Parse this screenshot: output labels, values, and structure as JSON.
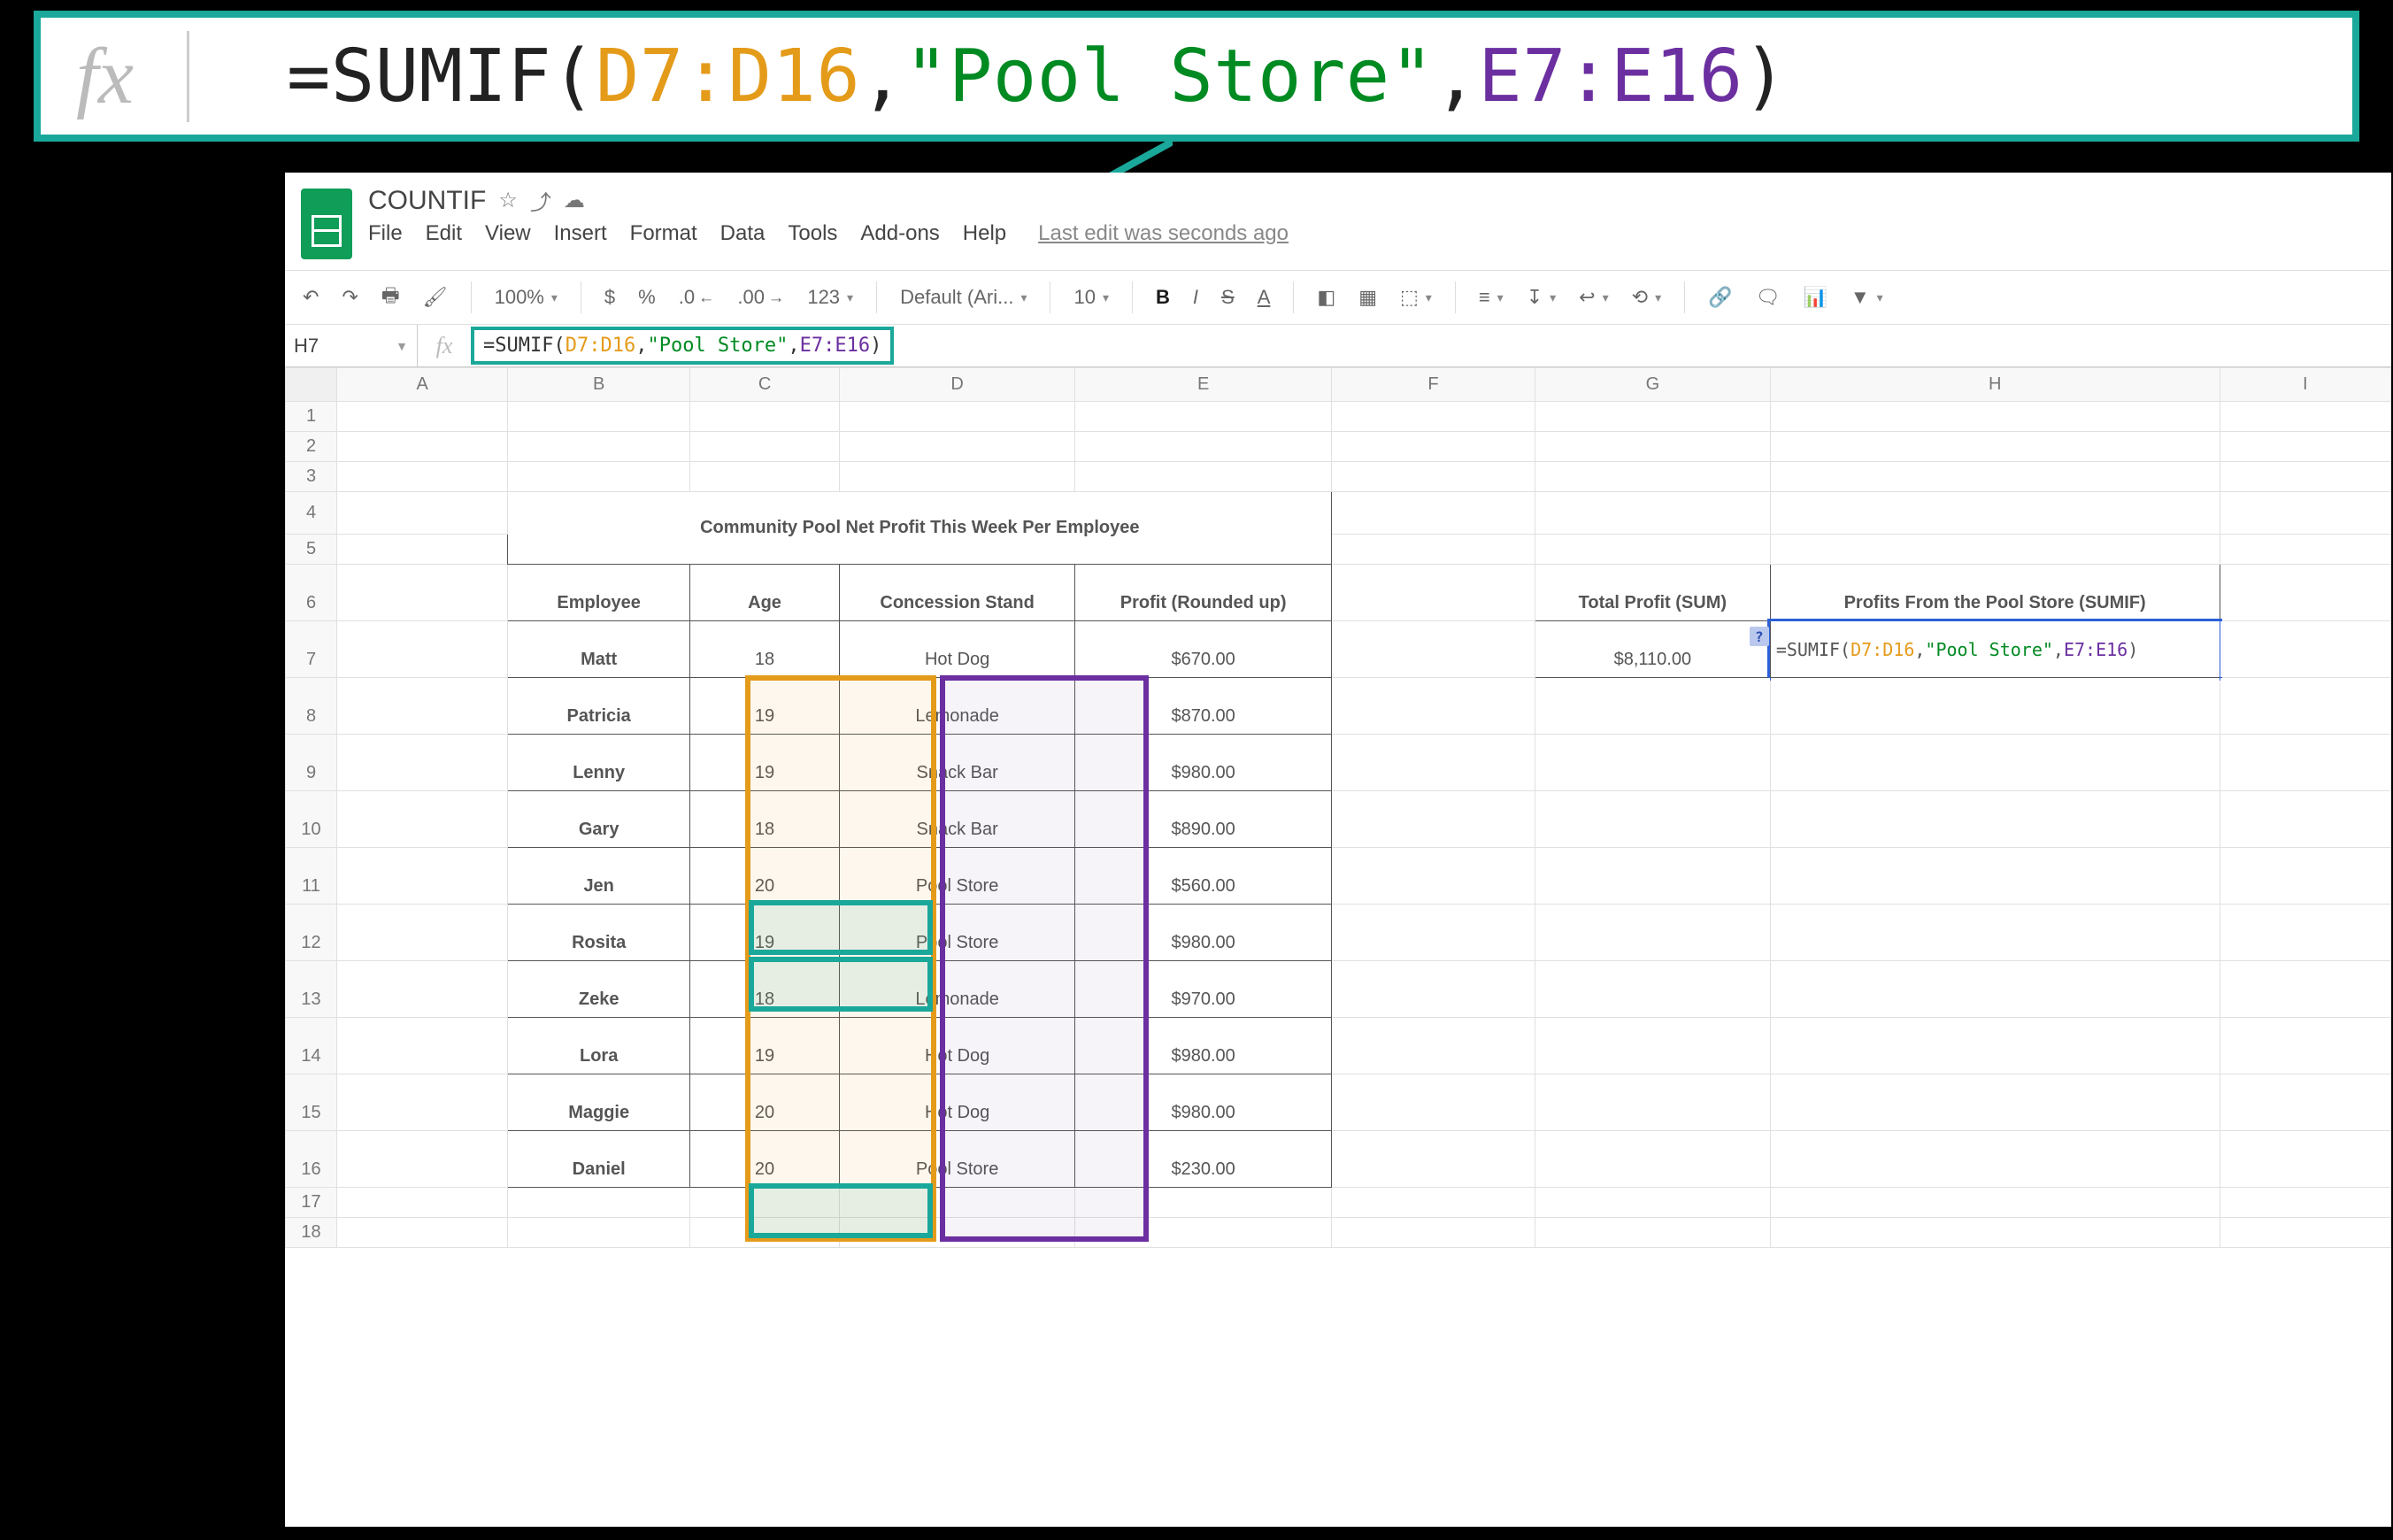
{
  "callout": {
    "eq": "=SUMIF(",
    "r1": "D7:D16",
    "c1": ",",
    "crit": "\"Pool Store\"",
    "c2": ",",
    "r2": "E7:E16",
    "close": ")"
  },
  "doc": {
    "title": "COUNTIF",
    "last_edit": "Last edit was seconds ago"
  },
  "menu": {
    "file": "File",
    "edit": "Edit",
    "view": "View",
    "insert": "Insert",
    "format": "Format",
    "data": "Data",
    "tools": "Tools",
    "addons": "Add-ons",
    "help": "Help"
  },
  "toolbar": {
    "zoom": "100%",
    "dollar": "$",
    "percent": "%",
    "dec_less": ".0",
    "dec_more": ".00",
    "num": "123",
    "font": "Default (Ari...",
    "size": "10",
    "bold": "B",
    "italic": "I",
    "strike": "S",
    "color": "A"
  },
  "namebox": "H7",
  "fbar": {
    "eq": "=SUMIF(",
    "r1": "D7:D16",
    "c1": ",",
    "crit": "\"Pool Store\"",
    "c2": ",",
    "r2": "E7:E16",
    "close": ")"
  },
  "cols": [
    "A",
    "B",
    "C",
    "D",
    "E",
    "F",
    "G",
    "H",
    "I"
  ],
  "rows": [
    "1",
    "2",
    "3",
    "4",
    "5",
    "6",
    "7",
    "8",
    "9",
    "10",
    "11",
    "12",
    "13",
    "14",
    "15",
    "16",
    "17",
    "18"
  ],
  "table": {
    "title": "Community Pool Net Profit This Week Per Employee",
    "headers": {
      "emp": "Employee",
      "age": "Age",
      "stand": "Concession Stand",
      "profit": "Profit (Rounded up)"
    },
    "rows": [
      {
        "emp": "Matt",
        "age": "18",
        "stand": "Hot Dog",
        "profit": "$670.00"
      },
      {
        "emp": "Patricia",
        "age": "19",
        "stand": "Lemonade",
        "profit": "$870.00"
      },
      {
        "emp": "Lenny",
        "age": "19",
        "stand": "Snack Bar",
        "profit": "$980.00"
      },
      {
        "emp": "Gary",
        "age": "18",
        "stand": "Snack Bar",
        "profit": "$890.00"
      },
      {
        "emp": "Jen",
        "age": "20",
        "stand": "Pool Store",
        "profit": "$560.00"
      },
      {
        "emp": "Rosita",
        "age": "19",
        "stand": "Pool Store",
        "profit": "$980.00"
      },
      {
        "emp": "Zeke",
        "age": "18",
        "stand": "Lemonade",
        "profit": "$970.00"
      },
      {
        "emp": "Lora",
        "age": "19",
        "stand": "Hot Dog",
        "profit": "$980.00"
      },
      {
        "emp": "Maggie",
        "age": "20",
        "stand": "Hot Dog",
        "profit": "$980.00"
      },
      {
        "emp": "Daniel",
        "age": "20",
        "stand": "Pool Store",
        "profit": "$230.00"
      }
    ]
  },
  "summary": {
    "sum_head": "Total Profit (SUM)",
    "sumif_head": "Profits From the Pool Store (SUMIF)",
    "sum_val": "$8,110.00"
  },
  "editing": {
    "eq": "=SUMIF(",
    "r1": "D7:D16",
    "c1": ",",
    "crit": "\"Pool Store\"",
    "c2": ",",
    "r2": "E7:E16",
    "close": ")",
    "q": "?"
  },
  "chart_data": {
    "type": "table",
    "title": "Community Pool Net Profit This Week Per Employee",
    "columns": [
      "Employee",
      "Age",
      "Concession Stand",
      "Profit (Rounded up)"
    ],
    "rows": [
      [
        "Matt",
        18,
        "Hot Dog",
        670.0
      ],
      [
        "Patricia",
        19,
        "Lemonade",
        870.0
      ],
      [
        "Lenny",
        19,
        "Snack Bar",
        980.0
      ],
      [
        "Gary",
        18,
        "Snack Bar",
        890.0
      ],
      [
        "Jen",
        20,
        "Pool Store",
        560.0
      ],
      [
        "Rosita",
        19,
        "Pool Store",
        980.0
      ],
      [
        "Zeke",
        18,
        "Lemonade",
        970.0
      ],
      [
        "Lora",
        19,
        "Hot Dog",
        980.0
      ],
      [
        "Maggie",
        20,
        "Hot Dog",
        980.0
      ],
      [
        "Daniel",
        20,
        "Pool Store",
        230.0
      ]
    ],
    "summary": {
      "Total Profit (SUM)": 8110.0,
      "SUMIF criterion": "Pool Store",
      "SUMIF range": "D7:D16",
      "SUMIF sum_range": "E7:E16"
    }
  }
}
